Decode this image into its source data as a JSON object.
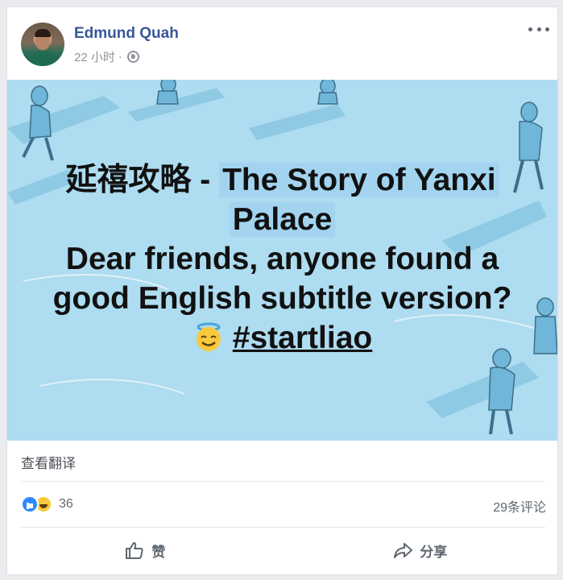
{
  "post": {
    "author": "Edmund Quah",
    "time": "22 小时",
    "separator": "·",
    "text": {
      "title_cn": "延禧攻略",
      "dash": "-",
      "title_en_1": "The Story of Yanxi",
      "title_en_2": "Palace",
      "line1": "Dear friends, anyone found a",
      "line2": "good English subtitle version?",
      "hashtag": "#startliao"
    },
    "translate_link": "查看翻译",
    "reaction_count": "36",
    "comment_count": "29条评论",
    "actions": {
      "like": "赞",
      "share": "分享"
    },
    "colors": {
      "name": "#385898",
      "image_bg": "#aedcf0",
      "like_blue": "#2e89ff"
    },
    "icons": [
      "globe-icon",
      "more-icon",
      "angel-emoji-icon",
      "like-reaction-icon",
      "haha-reaction-icon",
      "thumbs-up-icon",
      "share-icon"
    ]
  }
}
